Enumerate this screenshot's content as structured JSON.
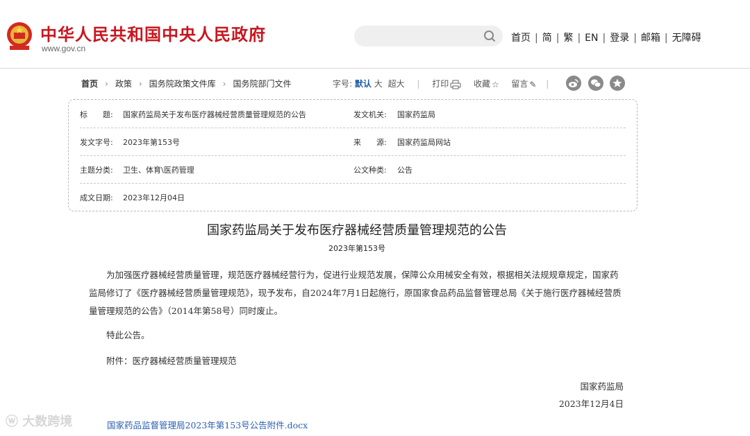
{
  "header": {
    "site_title": "中华人民共和国中央人民政府",
    "site_url": "www.gov.cn",
    "search_placeholder": "",
    "nav": [
      "首页",
      "简",
      "繁",
      "EN",
      "登录",
      "邮箱",
      "无障碍"
    ]
  },
  "breadcrumb": [
    "首页",
    "政策",
    "国务院政策文件库",
    "国务院部门文件"
  ],
  "tools": {
    "font_label": "字号:",
    "font_default": "默认",
    "font_large": "大",
    "font_xlarge": "超大",
    "print": "打印",
    "favorite": "收藏",
    "comment": "留言"
  },
  "info": {
    "title_label": "标　　题:",
    "title_value": "国家药监局关于发布医疗器械经营质量管理规范的公告",
    "issuer_label": "发文机关:",
    "issuer_value": "国家药监局",
    "docno_label": "发文字号:",
    "docno_value": "2023年第153号",
    "source_label": "来　　源:",
    "source_value": "国家药监局网站",
    "topic_label": "主题分类:",
    "topic_value": "卫生、体育\\医药管理",
    "type_label": "公文种类:",
    "type_value": "公告",
    "date_label": "成文日期:",
    "date_value": "2023年12月04日"
  },
  "article": {
    "title": "国家药监局关于发布医疗器械经营质量管理规范的公告",
    "number": "2023年第153号",
    "body": "为加强医疗器械经营质量管理，规范医疗器械经营行为，促进行业规范发展，保障公众用械安全有效，根据相关法规规章规定，国家药监局修订了《医疗器械经营质量管理规范》，现予发布，自2024年7月1日起施行，原国家食品药品监督管理总局《关于施行医疗器械经营质量管理规范的公告》（2014年第58号）同时废止。",
    "notice": "特此公告。",
    "attachment": "附件：医疗器械经营质量管理规范",
    "signer": "国家药监局",
    "sign_date": "2023年12月4日",
    "attachment_link": "国家药品监督管理局2023年第153号公告附件.docx"
  },
  "watermark": "大数跨境",
  "colors": {
    "brand_red": "#c8161e",
    "link_blue": "#2b5fb0",
    "active_blue": "#1f5fa8"
  }
}
